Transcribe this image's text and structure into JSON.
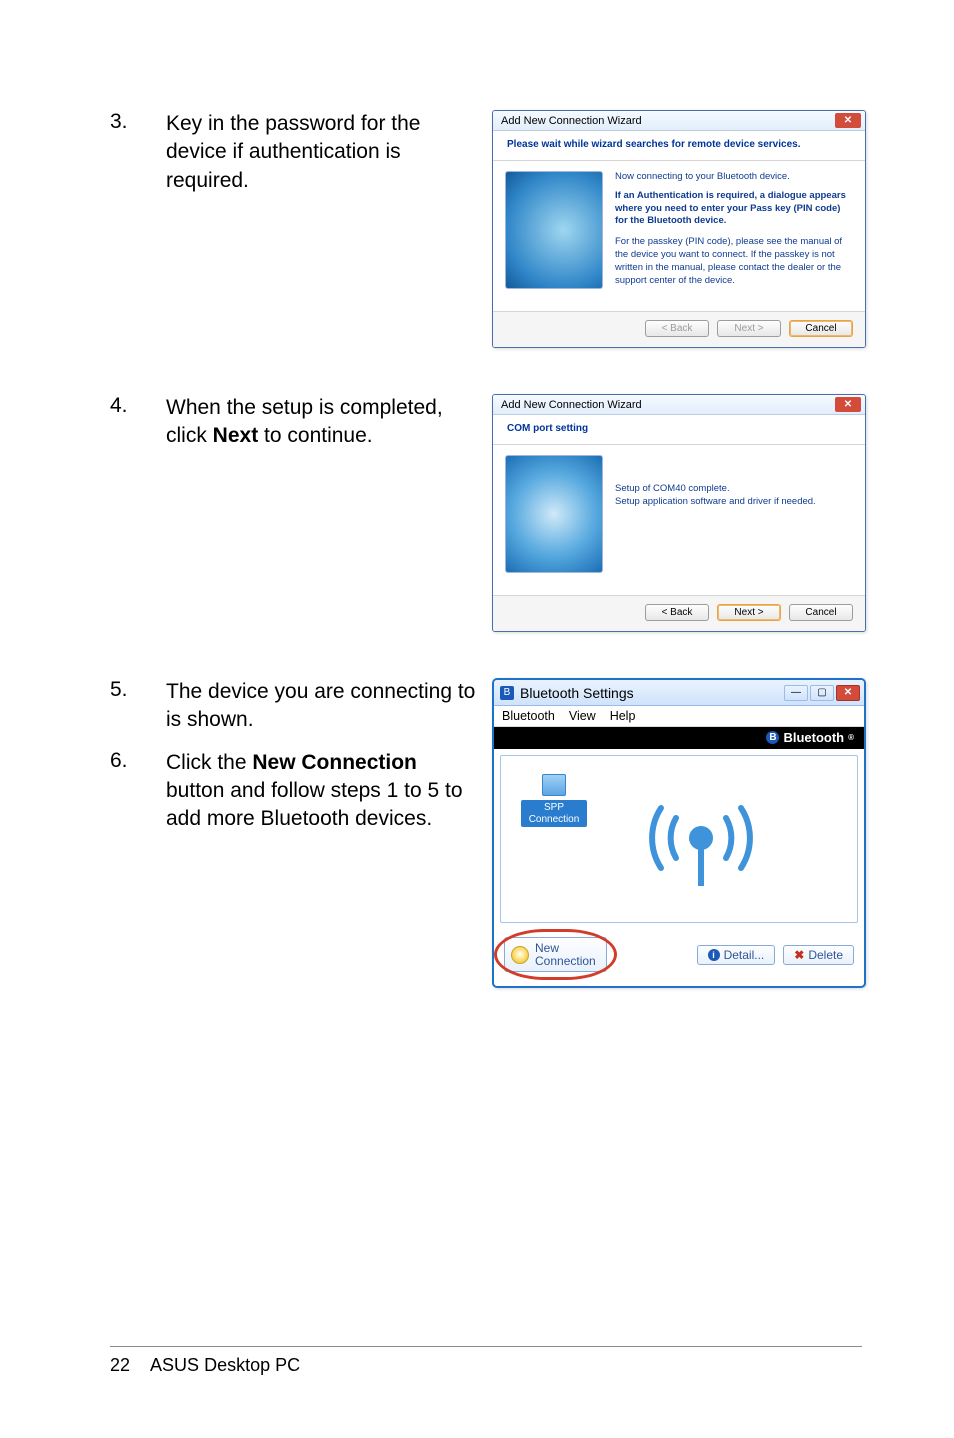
{
  "steps": {
    "s3": {
      "num": "3.",
      "text_a": "Key in the password for the device if authentication is required."
    },
    "s4": {
      "num": "4.",
      "text_a": "When the setup is completed, click ",
      "bold": "Next",
      "text_b": " to continue."
    },
    "s5": {
      "num": "5.",
      "text_a": "The device you are connecting to is shown."
    },
    "s6": {
      "num": "6.",
      "text_a": "Click the ",
      "bold": "New Connection",
      "text_b": " button and follow steps 1 to 5 to add more Bluetooth devices."
    }
  },
  "wizard1": {
    "title": "Add New Connection Wizard",
    "head": "Please wait while wizard searches for remote device services.",
    "line1": "Now connecting to your Bluetooth device.",
    "strong": "If an Authentication is required, a dialogue appears where you need to enter your Pass key (PIN code) for the Bluetooth device.",
    "line2": "For the passkey (PIN code), please see the manual of the device you want to connect. If the passkey is not written in the manual, please contact the dealer or the support center of the device.",
    "back": "< Back",
    "next": "Next >",
    "cancel": "Cancel"
  },
  "wizard2": {
    "title": "Add New Connection Wizard",
    "head": "COM port setting",
    "line1": "Setup of COM40 complete.",
    "line2": "Setup application software and driver if needed.",
    "back": "< Back",
    "next": "Next >",
    "cancel": "Cancel"
  },
  "btwin": {
    "title": "Bluetooth Settings",
    "menu": {
      "m1": "Bluetooth",
      "m2": "View",
      "m3": "Help"
    },
    "brand": "Bluetooth",
    "device": {
      "l1": "SPP",
      "l2": "Connection"
    },
    "newconn": {
      "l1": "New",
      "l2": "Connection"
    },
    "detail": "Detail...",
    "delete": "Delete"
  },
  "footer": {
    "page": "22",
    "title": "ASUS Desktop PC"
  }
}
